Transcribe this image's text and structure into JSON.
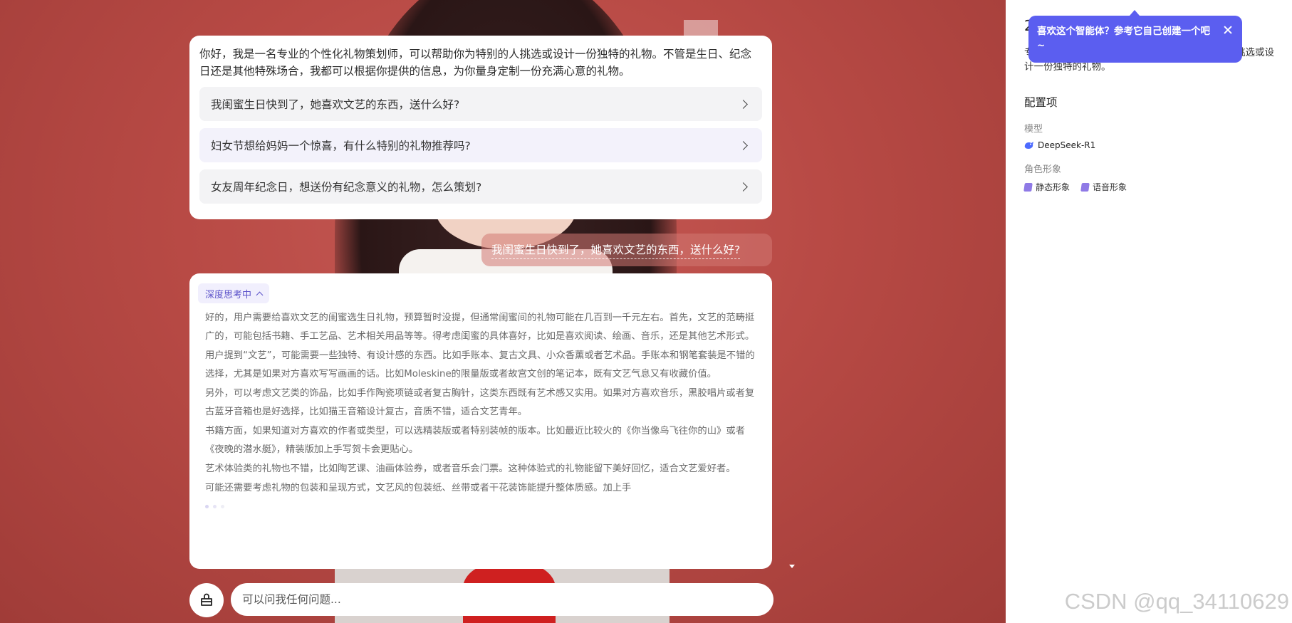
{
  "welcome": {
    "text": "你好，我是一名专业的个性化礼物策划师，可以帮助你为特别的人挑选或设计一份独特的礼物。不管是生日、纪念日还是其他特殊场合，我都可以根据你提供的信息，为你量身定制一份充满心意的礼物。",
    "suggestions": [
      "我闺蜜生日快到了，她喜欢文艺的东西，送什么好?",
      "妇女节想给妈妈一个惊喜，有什么特别的礼物推荐吗?",
      "女友周年纪念日，想送份有纪念意义的礼物，怎么策划?"
    ]
  },
  "user_message": "我闺蜜生日快到了，她喜欢文艺的东西，送什么好?",
  "answer": {
    "think_label": "深度思考中",
    "paragraphs": [
      "好的，用户需要给喜欢文艺的闺蜜选生日礼物，预算暂时没提，但通常闺蜜间的礼物可能在几百到一千元左右。首先，文艺的范畴挺广的，可能包括书籍、手工艺品、艺术相关用品等等。得考虑闺蜜的具体喜好，比如是喜欢阅读、绘画、音乐，还是其他艺术形式。",
      "用户提到“文艺”，可能需要一些独特、有设计感的东西。比如手账本、复古文具、小众香薰或者艺术品。手账本和钢笔套装是不错的选择，尤其是如果对方喜欢写写画画的话。比如Moleskine的限量版或者故宫文创的笔记本，既有文艺气息又有收藏价值。",
      "另外，可以考虑文艺类的饰品，比如手作陶瓷项链或者复古胸针，这类东西既有艺术感又实用。如果对方喜欢音乐，黑胶唱片或者复古蓝牙音箱也是好选择，比如猫王音箱设计复古，音质不错，适合文艺青年。",
      "书籍方面，如果知道对方喜欢的作者或类型，可以选精装版或者特别装帧的版本。比如最近比较火的《你当像鸟飞往你的山》或者《夜晚的潜水艇》，精装版加上手写贺卡会更贴心。",
      "艺术体验类的礼物也不错，比如陶艺课、油画体验券，或者音乐会门票。这种体验式的礼物能留下美好回忆，适合文艺爱好者。",
      "可能还需要考虑礼物的包装和呈现方式，文艺风的包装纸、丝带或者干花装饰能提升整体质感。加上手"
    ]
  },
  "input": {
    "placeholder": "可以问我任何问题..."
  },
  "panel": {
    "title_char": "2",
    "intro": "专业的个性化礼物策划师，可以帮助你为特别的人挑选或设计一份独特的礼物。",
    "section_title": "配置项",
    "model_label": "模型",
    "model_value": "DeepSeek-R1",
    "role_label": "角色形象",
    "role_chips": [
      "静态形象",
      "语音形象"
    ]
  },
  "tooltip": {
    "text": "喜欢这个智能体？参考它自己创建一个吧~"
  },
  "watermark": "CSDN @qq_34110629",
  "colors": {
    "accent": "#5b5ef0",
    "think_badge": "#5b52c9",
    "background": "#b84a45"
  }
}
